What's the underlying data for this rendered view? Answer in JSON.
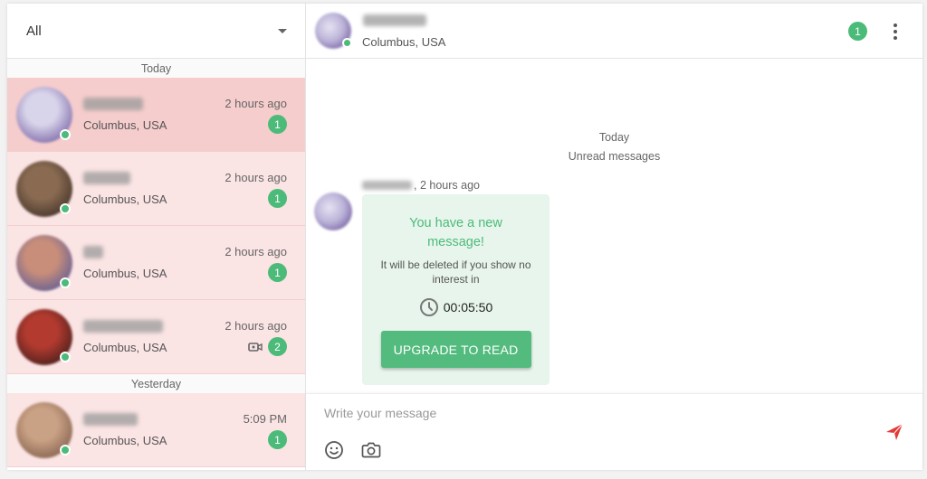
{
  "filter": {
    "label": "All"
  },
  "sidebar": {
    "sections": [
      {
        "label": "Today"
      },
      {
        "label": "Yesterday"
      }
    ],
    "conversations": [
      {
        "location": "Columbus, USA",
        "time": "2 hours ago",
        "unread": "1",
        "video": false,
        "name_blur_width": 66,
        "avatar_colors": [
          "#d8d4ea",
          "#5a3f8f"
        ]
      },
      {
        "location": "Columbus, USA",
        "time": "2 hours ago",
        "unread": "1",
        "video": false,
        "name_blur_width": 52,
        "avatar_colors": [
          "#8a6b52",
          "#2a1f1a"
        ]
      },
      {
        "location": "Columbus, USA",
        "time": "2 hours ago",
        "unread": "1",
        "video": false,
        "name_blur_width": 22,
        "avatar_colors": [
          "#c98e7a",
          "#3a4aa0"
        ]
      },
      {
        "location": "Columbus, USA",
        "time": "2 hours ago",
        "unread": "2",
        "video": true,
        "name_blur_width": 88,
        "avatar_colors": [
          "#b23a2f",
          "#1f1414"
        ]
      },
      {
        "location": "Columbus, USA",
        "time": "5:09 PM",
        "unread": "1",
        "video": false,
        "name_blur_width": 60,
        "avatar_colors": [
          "#c9a184",
          "#6b4a3a"
        ]
      }
    ]
  },
  "chat": {
    "header": {
      "location": "Columbus, USA",
      "unread": "1"
    },
    "day_label": "Today",
    "unread_label": "Unread messages",
    "message": {
      "time_suffix": ", 2 hours ago",
      "title": "You have a new message!",
      "text": "It will be deleted if you show no interest in",
      "timer": "00:05:50",
      "button": "UPGRADE TO READ"
    },
    "composer": {
      "placeholder": "Write your message"
    }
  },
  "colors": {
    "accent_green": "#4cbb7a",
    "active_row": "#f6cdcd",
    "row": "#fbe4e4",
    "send_red": "#e53935"
  }
}
